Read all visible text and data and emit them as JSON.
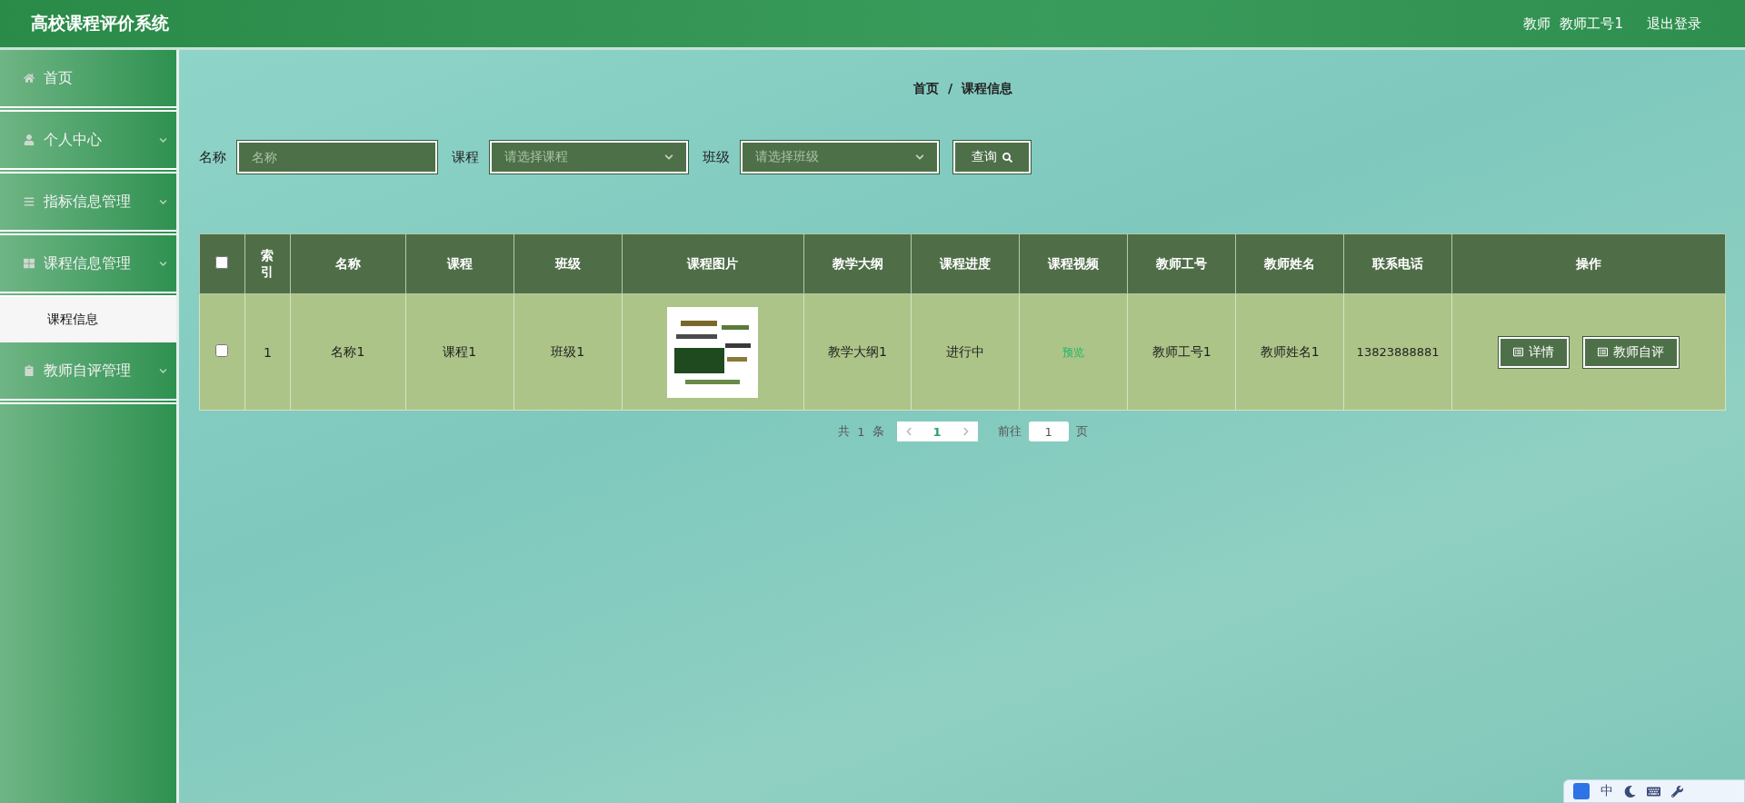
{
  "header": {
    "title": "高校课程评价系统",
    "role": "教师",
    "user": "教师工号1",
    "logout": "退出登录"
  },
  "sidebar": {
    "items": [
      {
        "label": "首页",
        "expandable": false
      },
      {
        "label": "个人中心",
        "expandable": true
      },
      {
        "label": "指标信息管理",
        "expandable": true
      },
      {
        "label": "课程信息管理",
        "expandable": true,
        "children": [
          {
            "label": "课程信息",
            "selected": true
          }
        ]
      },
      {
        "label": "教师自评管理",
        "expandable": true
      }
    ]
  },
  "breadcrumb": [
    "首页",
    "/",
    "课程信息"
  ],
  "search": {
    "fields": [
      {
        "kind": "input",
        "label": "名称",
        "placeholder": "名称"
      },
      {
        "kind": "select",
        "label": "课程",
        "placeholder": "请选择课程"
      },
      {
        "kind": "select",
        "label": "班级",
        "placeholder": "请选择班级"
      }
    ],
    "button": "查询"
  },
  "table": {
    "select_all_checked": false,
    "columns": [
      "索引",
      "名称",
      "课程",
      "班级",
      "课程图片",
      "教学大纲",
      "课程进度",
      "课程视频",
      "教师工号",
      "教师姓名",
      "联系电话",
      "操作"
    ],
    "rows": [
      {
        "checked": false,
        "index": "1",
        "name": "名称1",
        "course": "课程1",
        "class": "班级1",
        "syllabus": "教学大纲1",
        "progress": "进行中",
        "video": "预览",
        "teacher_id": "教师工号1",
        "teacher_name": "教师姓名1",
        "phone": "13823888881",
        "actions": [
          "详情",
          "教师自评"
        ]
      }
    ]
  },
  "pagination": {
    "total_prefix": "共",
    "total": "1",
    "total_suffix": "条",
    "pages": [
      {
        "label": "1",
        "selected": true
      }
    ],
    "goto_label": "前往",
    "goto_value": "1",
    "goto_suffix": "页"
  },
  "ime": {
    "mode": "中"
  }
}
